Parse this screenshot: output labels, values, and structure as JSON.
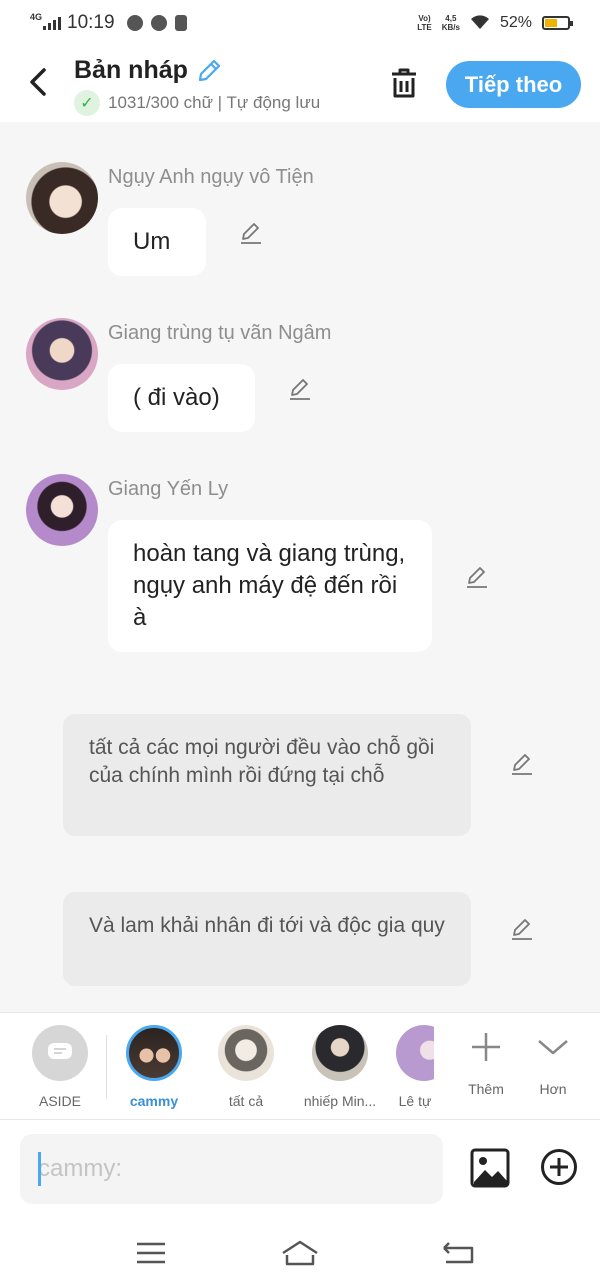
{
  "status_bar": {
    "network": "4G",
    "time": "10:19",
    "volte": "Vo)\nLTE",
    "speed": "4,5\nKB/s",
    "battery": "52%",
    "battery_level": 0.52
  },
  "header": {
    "title": "Bản nháp",
    "subtitle": "1031/300 chữ | Tự động lưu",
    "next_label": "Tiếp theo"
  },
  "messages": [
    {
      "type": "character",
      "name": "Ngụy Anh ngụy vô Tiện",
      "text": "Um"
    },
    {
      "type": "character",
      "name": "Giang trùng tụ vãn Ngâm",
      "text": "( đi vào)"
    },
    {
      "type": "character",
      "name": "Giang Yến Ly",
      "text": "hoàn tang và giang trùng, ngụy anh máy đệ đến rồi à"
    },
    {
      "type": "aside",
      "text": "tất cả các mọi người đều vào chỗ gồi của chính mình rồi đứng tại chỗ"
    },
    {
      "type": "aside",
      "text": "Và lam khải nhân đi tới và độc gia quy"
    }
  ],
  "character_bar": {
    "items": [
      {
        "label": "ASIDE"
      },
      {
        "label": "cammy"
      },
      {
        "label": "tất cả"
      },
      {
        "label": "nhiếp Min..."
      },
      {
        "label": "Lê tự"
      }
    ],
    "add_label": "Thêm",
    "more_label": "Hơn"
  },
  "composer": {
    "placeholder": "cammy:"
  },
  "colors": {
    "accent": "#4aa8f0",
    "check": "#35b24a",
    "background": "#f6f6f6"
  }
}
